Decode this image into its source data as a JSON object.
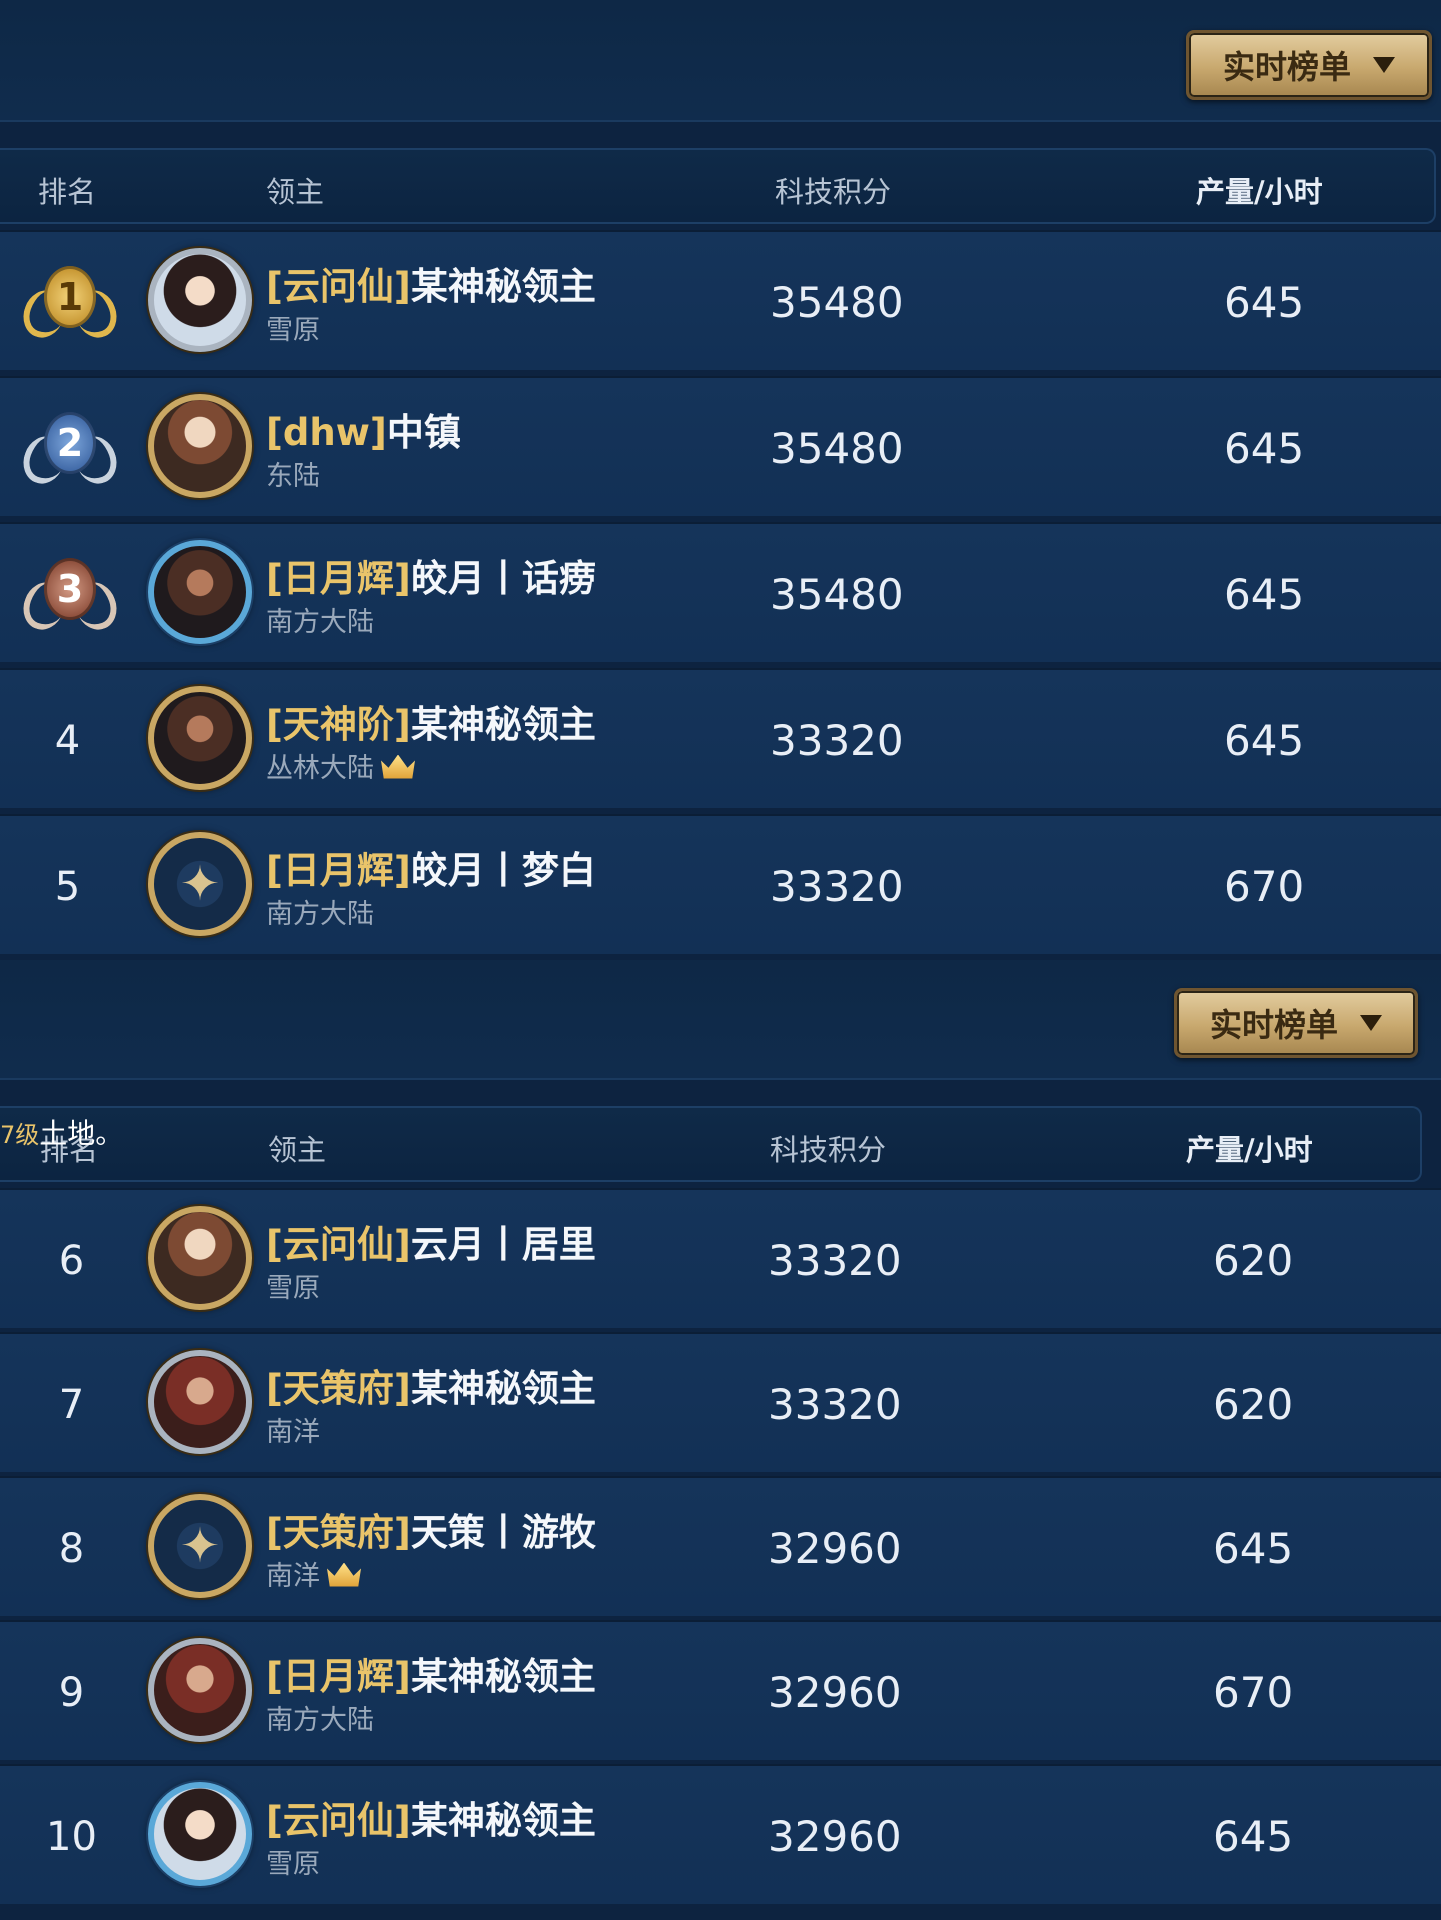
{
  "panel1": {
    "dropdown_label": "实时榜单",
    "columns": {
      "rank": "排名",
      "lord": "领主",
      "score": "科技积分",
      "production": "产量/小时"
    },
    "rows": [
      {
        "rank": "1",
        "guild": "[云问仙]",
        "name": "某神秘领主",
        "region": "雪原",
        "score": "35480",
        "production": "645"
      },
      {
        "rank": "2",
        "guild": "[dhw]",
        "name": "中镇",
        "region": "东陆",
        "score": "35480",
        "production": "645"
      },
      {
        "rank": "3",
        "guild": "[日月辉]",
        "name": "皎月丨话痨",
        "region": "南方大陆",
        "score": "35480",
        "production": "645"
      },
      {
        "rank": "4",
        "guild": "[天神阶]",
        "name": "某神秘领主",
        "region": "丛林大陆",
        "score": "33320",
        "production": "645"
      },
      {
        "rank": "5",
        "guild": "[日月辉]",
        "name": "皎月丨梦白",
        "region": "南方大陆",
        "score": "33320",
        "production": "670"
      }
    ]
  },
  "panel2": {
    "dropdown_label": "实时榜单",
    "overlay_note": {
      "level": "7级",
      "text": "土地。"
    },
    "columns": {
      "rank": "排名",
      "lord": "领主",
      "score": "科技积分",
      "production": "产量/小时"
    },
    "rows": [
      {
        "rank": "6",
        "guild": "[云问仙]",
        "name": "云月丨居里",
        "region": "雪原",
        "score": "33320",
        "production": "620"
      },
      {
        "rank": "7",
        "guild": "[天策府]",
        "name": "某神秘领主",
        "region": "南洋",
        "score": "33320",
        "production": "620"
      },
      {
        "rank": "8",
        "guild": "[天策府]",
        "name": "天策丨游牧",
        "region": "南洋",
        "score": "32960",
        "production": "645"
      },
      {
        "rank": "9",
        "guild": "[日月辉]",
        "name": "某神秘领主",
        "region": "南方大陆",
        "score": "32960",
        "production": "670"
      },
      {
        "rank": "10",
        "guild": "[云问仙]",
        "name": "某神秘领主",
        "region": "雪原",
        "score": "32960",
        "production": "645"
      }
    ]
  },
  "icons": {
    "medals": [
      "gold-medal-icon",
      "silver-medal-icon",
      "bronze-medal-icon"
    ],
    "crown": "crown-icon",
    "dropdown": "caret-down-icon"
  },
  "colors": {
    "guild_tag": "#e9c46a",
    "background": "#0d2340",
    "button_gold": "#c8a86e"
  }
}
